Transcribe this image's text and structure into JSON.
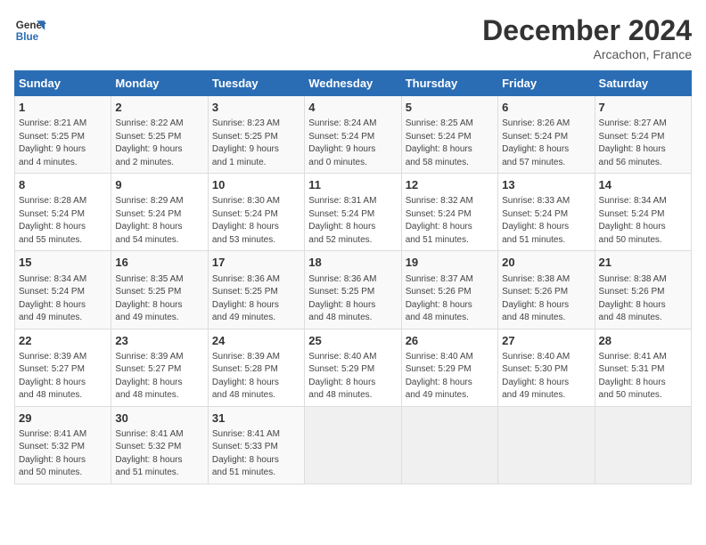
{
  "header": {
    "logo_line1": "General",
    "logo_line2": "Blue",
    "title": "December 2024",
    "location": "Arcachon, France"
  },
  "days_of_week": [
    "Sunday",
    "Monday",
    "Tuesday",
    "Wednesday",
    "Thursday",
    "Friday",
    "Saturday"
  ],
  "weeks": [
    [
      {
        "day": "1",
        "info": "Sunrise: 8:21 AM\nSunset: 5:25 PM\nDaylight: 9 hours\nand 4 minutes."
      },
      {
        "day": "2",
        "info": "Sunrise: 8:22 AM\nSunset: 5:25 PM\nDaylight: 9 hours\nand 2 minutes."
      },
      {
        "day": "3",
        "info": "Sunrise: 8:23 AM\nSunset: 5:25 PM\nDaylight: 9 hours\nand 1 minute."
      },
      {
        "day": "4",
        "info": "Sunrise: 8:24 AM\nSunset: 5:24 PM\nDaylight: 9 hours\nand 0 minutes."
      },
      {
        "day": "5",
        "info": "Sunrise: 8:25 AM\nSunset: 5:24 PM\nDaylight: 8 hours\nand 58 minutes."
      },
      {
        "day": "6",
        "info": "Sunrise: 8:26 AM\nSunset: 5:24 PM\nDaylight: 8 hours\nand 57 minutes."
      },
      {
        "day": "7",
        "info": "Sunrise: 8:27 AM\nSunset: 5:24 PM\nDaylight: 8 hours\nand 56 minutes."
      }
    ],
    [
      {
        "day": "8",
        "info": "Sunrise: 8:28 AM\nSunset: 5:24 PM\nDaylight: 8 hours\nand 55 minutes."
      },
      {
        "day": "9",
        "info": "Sunrise: 8:29 AM\nSunset: 5:24 PM\nDaylight: 8 hours\nand 54 minutes."
      },
      {
        "day": "10",
        "info": "Sunrise: 8:30 AM\nSunset: 5:24 PM\nDaylight: 8 hours\nand 53 minutes."
      },
      {
        "day": "11",
        "info": "Sunrise: 8:31 AM\nSunset: 5:24 PM\nDaylight: 8 hours\nand 52 minutes."
      },
      {
        "day": "12",
        "info": "Sunrise: 8:32 AM\nSunset: 5:24 PM\nDaylight: 8 hours\nand 51 minutes."
      },
      {
        "day": "13",
        "info": "Sunrise: 8:33 AM\nSunset: 5:24 PM\nDaylight: 8 hours\nand 51 minutes."
      },
      {
        "day": "14",
        "info": "Sunrise: 8:34 AM\nSunset: 5:24 PM\nDaylight: 8 hours\nand 50 minutes."
      }
    ],
    [
      {
        "day": "15",
        "info": "Sunrise: 8:34 AM\nSunset: 5:24 PM\nDaylight: 8 hours\nand 49 minutes."
      },
      {
        "day": "16",
        "info": "Sunrise: 8:35 AM\nSunset: 5:25 PM\nDaylight: 8 hours\nand 49 minutes."
      },
      {
        "day": "17",
        "info": "Sunrise: 8:36 AM\nSunset: 5:25 PM\nDaylight: 8 hours\nand 49 minutes."
      },
      {
        "day": "18",
        "info": "Sunrise: 8:36 AM\nSunset: 5:25 PM\nDaylight: 8 hours\nand 48 minutes."
      },
      {
        "day": "19",
        "info": "Sunrise: 8:37 AM\nSunset: 5:26 PM\nDaylight: 8 hours\nand 48 minutes."
      },
      {
        "day": "20",
        "info": "Sunrise: 8:38 AM\nSunset: 5:26 PM\nDaylight: 8 hours\nand 48 minutes."
      },
      {
        "day": "21",
        "info": "Sunrise: 8:38 AM\nSunset: 5:26 PM\nDaylight: 8 hours\nand 48 minutes."
      }
    ],
    [
      {
        "day": "22",
        "info": "Sunrise: 8:39 AM\nSunset: 5:27 PM\nDaylight: 8 hours\nand 48 minutes."
      },
      {
        "day": "23",
        "info": "Sunrise: 8:39 AM\nSunset: 5:27 PM\nDaylight: 8 hours\nand 48 minutes."
      },
      {
        "day": "24",
        "info": "Sunrise: 8:39 AM\nSunset: 5:28 PM\nDaylight: 8 hours\nand 48 minutes."
      },
      {
        "day": "25",
        "info": "Sunrise: 8:40 AM\nSunset: 5:29 PM\nDaylight: 8 hours\nand 48 minutes."
      },
      {
        "day": "26",
        "info": "Sunrise: 8:40 AM\nSunset: 5:29 PM\nDaylight: 8 hours\nand 49 minutes."
      },
      {
        "day": "27",
        "info": "Sunrise: 8:40 AM\nSunset: 5:30 PM\nDaylight: 8 hours\nand 49 minutes."
      },
      {
        "day": "28",
        "info": "Sunrise: 8:41 AM\nSunset: 5:31 PM\nDaylight: 8 hours\nand 50 minutes."
      }
    ],
    [
      {
        "day": "29",
        "info": "Sunrise: 8:41 AM\nSunset: 5:32 PM\nDaylight: 8 hours\nand 50 minutes."
      },
      {
        "day": "30",
        "info": "Sunrise: 8:41 AM\nSunset: 5:32 PM\nDaylight: 8 hours\nand 51 minutes."
      },
      {
        "day": "31",
        "info": "Sunrise: 8:41 AM\nSunset: 5:33 PM\nDaylight: 8 hours\nand 51 minutes."
      },
      {
        "day": "",
        "info": ""
      },
      {
        "day": "",
        "info": ""
      },
      {
        "day": "",
        "info": ""
      },
      {
        "day": "",
        "info": ""
      }
    ]
  ]
}
